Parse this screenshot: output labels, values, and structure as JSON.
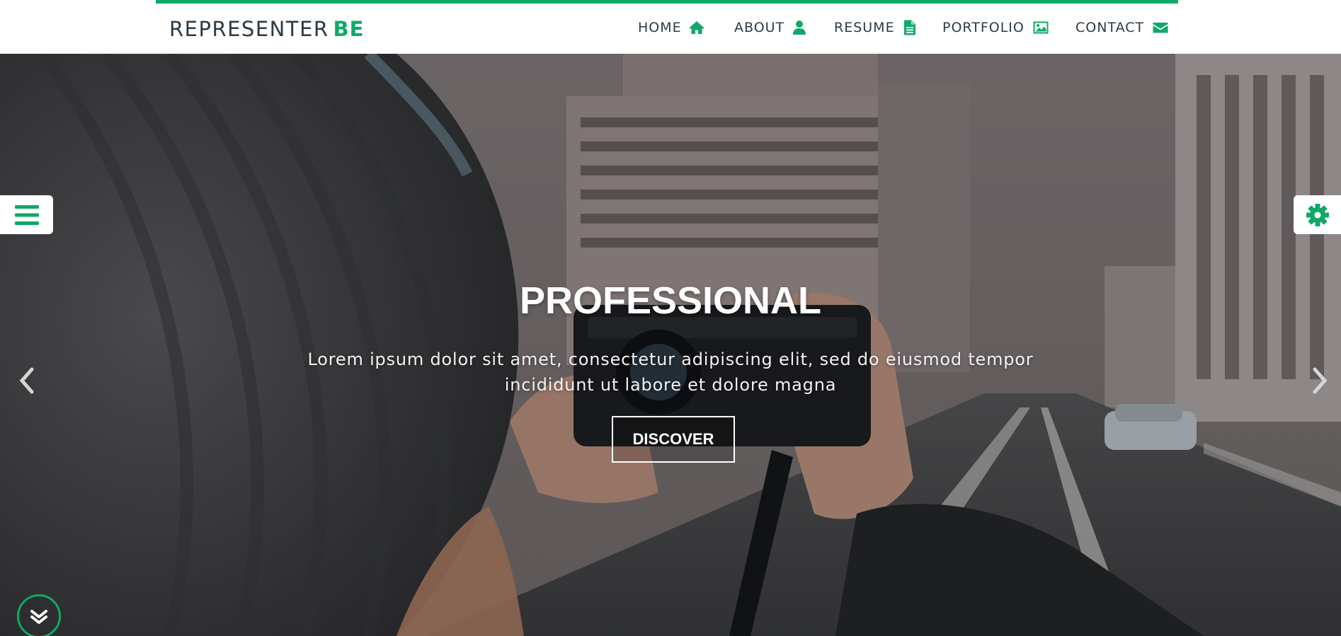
{
  "brand": {
    "name": "REPRESENTER",
    "accent": "BE"
  },
  "nav": [
    {
      "label": "HOME",
      "icon": "home-icon"
    },
    {
      "label": "ABOUT",
      "icon": "user-icon"
    },
    {
      "label": "RESUME",
      "icon": "document-icon"
    },
    {
      "label": "PORTFOLIO",
      "icon": "image-icon"
    },
    {
      "label": "CONTACT",
      "icon": "envelope-icon"
    }
  ],
  "hero": {
    "title": "PROFESSIONAL",
    "text": "Lorem ipsum dolor sit amet, consectetur adipiscing elit, sed do eiusmod tempor incididunt ut labore et dolore magna",
    "button": "DISCOVER"
  },
  "controls": {
    "menu_icon": "hamburger-menu-icon",
    "settings_icon": "gear-icon",
    "prev_icon": "chevron-left-icon",
    "next_icon": "chevron-right-icon",
    "scroll_icon": "double-chevron-down-icon"
  },
  "colors": {
    "accent": "#0fa968",
    "text_dark": "#2b3a44",
    "white": "#ffffff"
  }
}
